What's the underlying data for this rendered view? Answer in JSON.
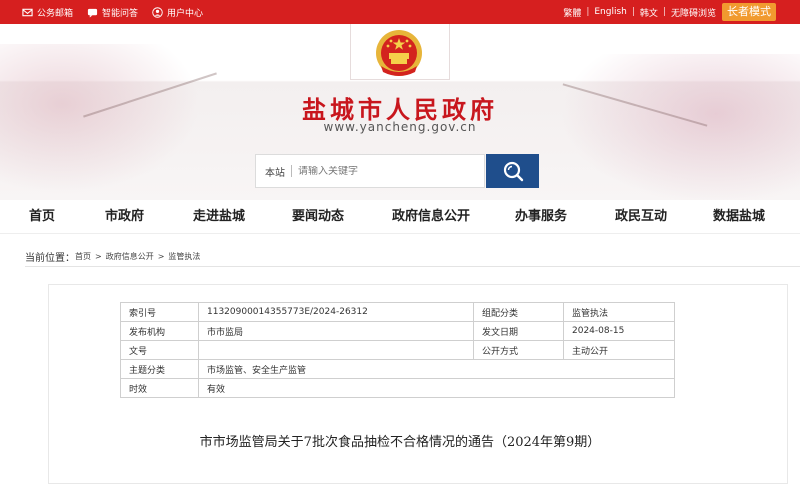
{
  "topbar": {
    "links": [
      "公务邮箱",
      "智能问答",
      "用户中心"
    ],
    "right_links": [
      "繁體",
      "English",
      "韩文",
      "无障碍浏览"
    ],
    "elder_mode": "长者模式"
  },
  "banner": {
    "title": "盐城市人民政府",
    "url": "www.yancheng.gov.cn"
  },
  "search": {
    "scope": "本站",
    "placeholder": "请输入关键字"
  },
  "nav": {
    "items": [
      "首页",
      "市政府",
      "走进盐城",
      "要闻动态",
      "政府信息公开",
      "办事服务",
      "政民互动",
      "数据盐城"
    ]
  },
  "breadcrumb": {
    "label": "当前位置：",
    "items": [
      "首页",
      "政府信息公开",
      "监管执法"
    ]
  },
  "meta": {
    "rows": [
      [
        "索引号",
        "11320900014355773E/2024-26312",
        "组配分类",
        "监管执法"
      ],
      [
        "发布机构",
        "市市监局",
        "发文日期",
        "2024-08-15"
      ],
      [
        "文号",
        "",
        "公开方式",
        "主动公开"
      ],
      [
        "主题分类",
        "市场监管、安全生产监管",
        "",
        ""
      ],
      [
        "时效",
        "有效",
        "",
        ""
      ]
    ]
  },
  "document": {
    "title": "市市场监管局关于7批次食品抽检不合格情况的通告（2024年第9期）"
  },
  "colors": {
    "topbar": "#d61f1f",
    "title_red": "#c8161d",
    "search_button": "#1f4e8c",
    "elder_button": "#f19a2f"
  }
}
